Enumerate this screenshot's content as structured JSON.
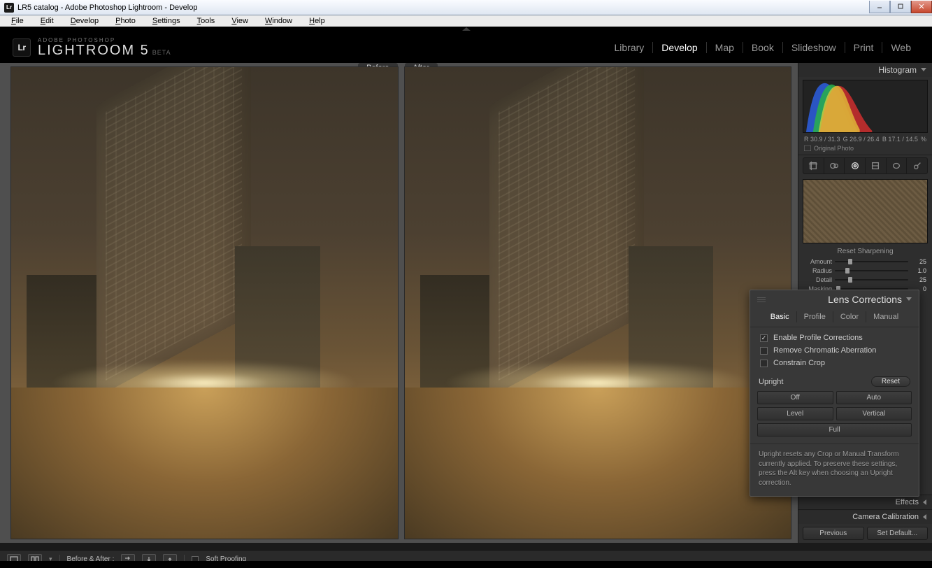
{
  "window": {
    "title": "LR5 catalog - Adobe Photoshop Lightroom - Develop"
  },
  "menubar": [
    "File",
    "Edit",
    "Develop",
    "Photo",
    "Settings",
    "Tools",
    "View",
    "Window",
    "Help"
  ],
  "header": {
    "badge": "Lr",
    "small": "ADOBE PHOTOSHOP",
    "big": "LIGHTROOM 5",
    "beta": "BETA",
    "modules": [
      "Library",
      "Develop",
      "Map",
      "Book",
      "Slideshow",
      "Print",
      "Web"
    ],
    "active_module": "Develop"
  },
  "compare": {
    "before": "Before",
    "after": "After"
  },
  "right": {
    "histogram_title": "Histogram",
    "readout": {
      "r": "R 30.9 / 31.3",
      "g": "G 26.9 / 26.4",
      "b": "B 17.1 / 14.5",
      "pct": "%"
    },
    "original_photo": "Original Photo",
    "sharpen": {
      "title": "Reset Sharpening",
      "rows": [
        {
          "label": "Amount",
          "value": "25",
          "pos": 18
        },
        {
          "label": "Radius",
          "value": "1.0",
          "pos": 14
        },
        {
          "label": "Detail",
          "value": "25",
          "pos": 18
        },
        {
          "label": "Masking",
          "value": "0",
          "pos": 2
        }
      ]
    },
    "panels": {
      "effects": "Effects",
      "camera_cal": "Camera Calibration"
    },
    "buttons": {
      "previous": "Previous",
      "set_default": "Set Default..."
    }
  },
  "lens": {
    "title": "Lens Corrections",
    "tabs": [
      "Basic",
      "Profile",
      "Color",
      "Manual"
    ],
    "active_tab": "Basic",
    "checks": {
      "enable_profile": "Enable Profile Corrections",
      "remove_ca": "Remove Chromatic Aberration",
      "constrain_crop": "Constrain Crop"
    },
    "upright_label": "Upright",
    "reset": "Reset",
    "buttons": {
      "off": "Off",
      "auto": "Auto",
      "level": "Level",
      "vertical": "Vertical",
      "full": "Full"
    },
    "note": "Upright resets any Crop or Manual Transform currently applied. To preserve these settings, press the Alt key when choosing an Upright correction."
  },
  "footer": {
    "before_after_label": "Before & After :",
    "soft_proofing": "Soft Proofing"
  }
}
